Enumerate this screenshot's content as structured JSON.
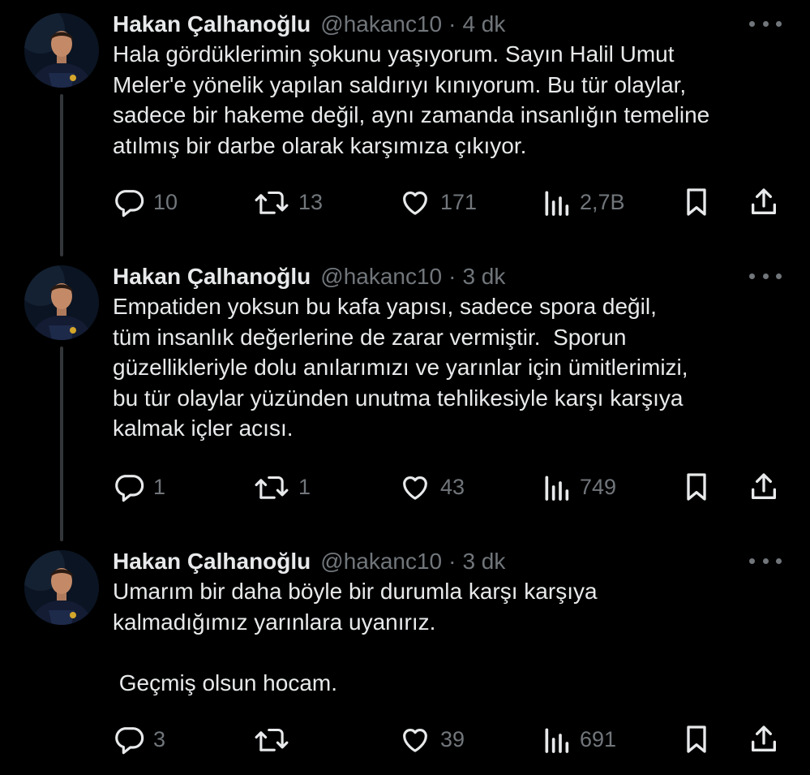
{
  "tweets": [
    {
      "name": "Hakan Çalhanoğlu",
      "handle": "@hakanc10",
      "dot": "·",
      "time": "4 dk",
      "text": "Hala gördüklerimin şokunu yaşıyorum. Sayın Halil Umut\nMeler'e yönelik yapılan saldırıyı kınıyorum. Bu tür olaylar,\nsadece bir hakeme değil, aynı zamanda insanlığın temeline\natılmış bir darbe olarak karşımıza çıkıyor.",
      "replies": "10",
      "retweets": "13",
      "likes": "171",
      "views": "2,7B"
    },
    {
      "name": "Hakan Çalhanoğlu",
      "handle": "@hakanc10",
      "dot": "·",
      "time": "3 dk",
      "text": "Empatiden yoksun bu kafa yapısı, sadece spora değil,\ntüm insanlık değerlerine de zarar vermiştir.  Sporun\ngüzellikleriyle dolu anılarımızı ve yarınlar için ümitlerimizi,\nbu tür olaylar yüzünden unutma tehlikesiyle karşı karşıya\nkalmak içler acısı.",
      "replies": "1",
      "retweets": "1",
      "likes": "43",
      "views": "749"
    },
    {
      "name": "Hakan Çalhanoğlu",
      "handle": "@hakanc10",
      "dot": "·",
      "time": "3 dk",
      "text": "Umarım bir daha böyle bir durumla karşı karşıya\nkalmadığımız yarınlara uyanırız.\n\n Geçmiş olsun hocam.",
      "replies": "3",
      "retweets": "",
      "likes": "39",
      "views": "691"
    }
  ],
  "icons": {
    "reply": "reply-icon",
    "retweet": "retweet-icon",
    "like": "heart-icon",
    "views": "views-icon",
    "bookmark": "bookmark-icon",
    "share": "share-icon",
    "more": "more-icon"
  },
  "colors": {
    "background": "#000000",
    "text": "#e7e9ea",
    "secondary": "#71767b",
    "thread_line": "#333639"
  }
}
